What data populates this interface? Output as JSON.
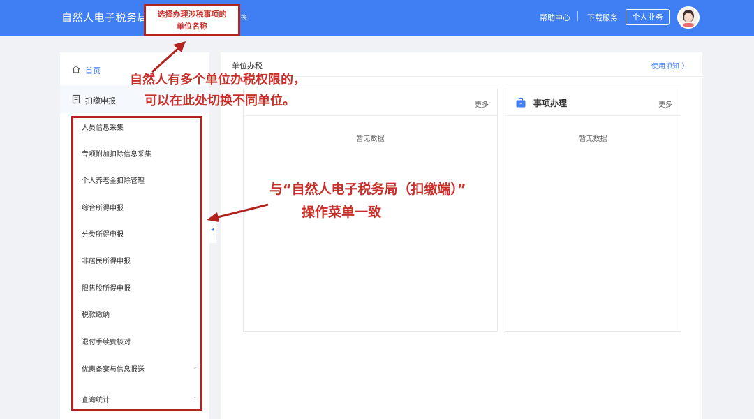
{
  "header": {
    "app_title": "自然人电子税务局",
    "org_switch_suffix": "换",
    "help_link": "帮助中心",
    "download_link": "下载服务",
    "personal_button": "个人业务",
    "brand_color": "#3f7ef3"
  },
  "sidebar": {
    "home_label": "首页",
    "home_icon": "home-icon",
    "declare_label": "扣缴申报",
    "declare_icon": "document-icon",
    "items": [
      {
        "label": "人员信息采集"
      },
      {
        "label": "专项附加扣除信息采集"
      },
      {
        "label": "个人养老金扣除管理"
      },
      {
        "label": "综合所得申报"
      },
      {
        "label": "分类所得申报"
      },
      {
        "label": "非居民所得申报"
      },
      {
        "label": "限售股所得申报"
      },
      {
        "label": "税款缴纳"
      },
      {
        "label": "退付手续费核对"
      },
      {
        "label": "优惠备案与信息报送",
        "has_chevron": true
      },
      {
        "label": "查询统计",
        "has_chevron": true
      }
    ]
  },
  "main": {
    "title": "单位办税",
    "notice_link": "使用须知 〉",
    "left_card": {
      "more": "更多",
      "empty": "暂无数据"
    },
    "right_card": {
      "title": "事项办理",
      "icon": "briefcase-icon",
      "more": "更多",
      "empty": "暂无数据"
    }
  },
  "annotations": {
    "box_note": "选择办理涉税事项的\n单位名称",
    "note_line1": "自然人有多个单位办税权限的，",
    "note_line2": "可以在此处切换不同单位。",
    "menu_note_line1": "与“自然人电子税务局（扣缴端）”",
    "menu_note_line2": "操作菜单一致",
    "annotation_color": "#c7302a"
  }
}
